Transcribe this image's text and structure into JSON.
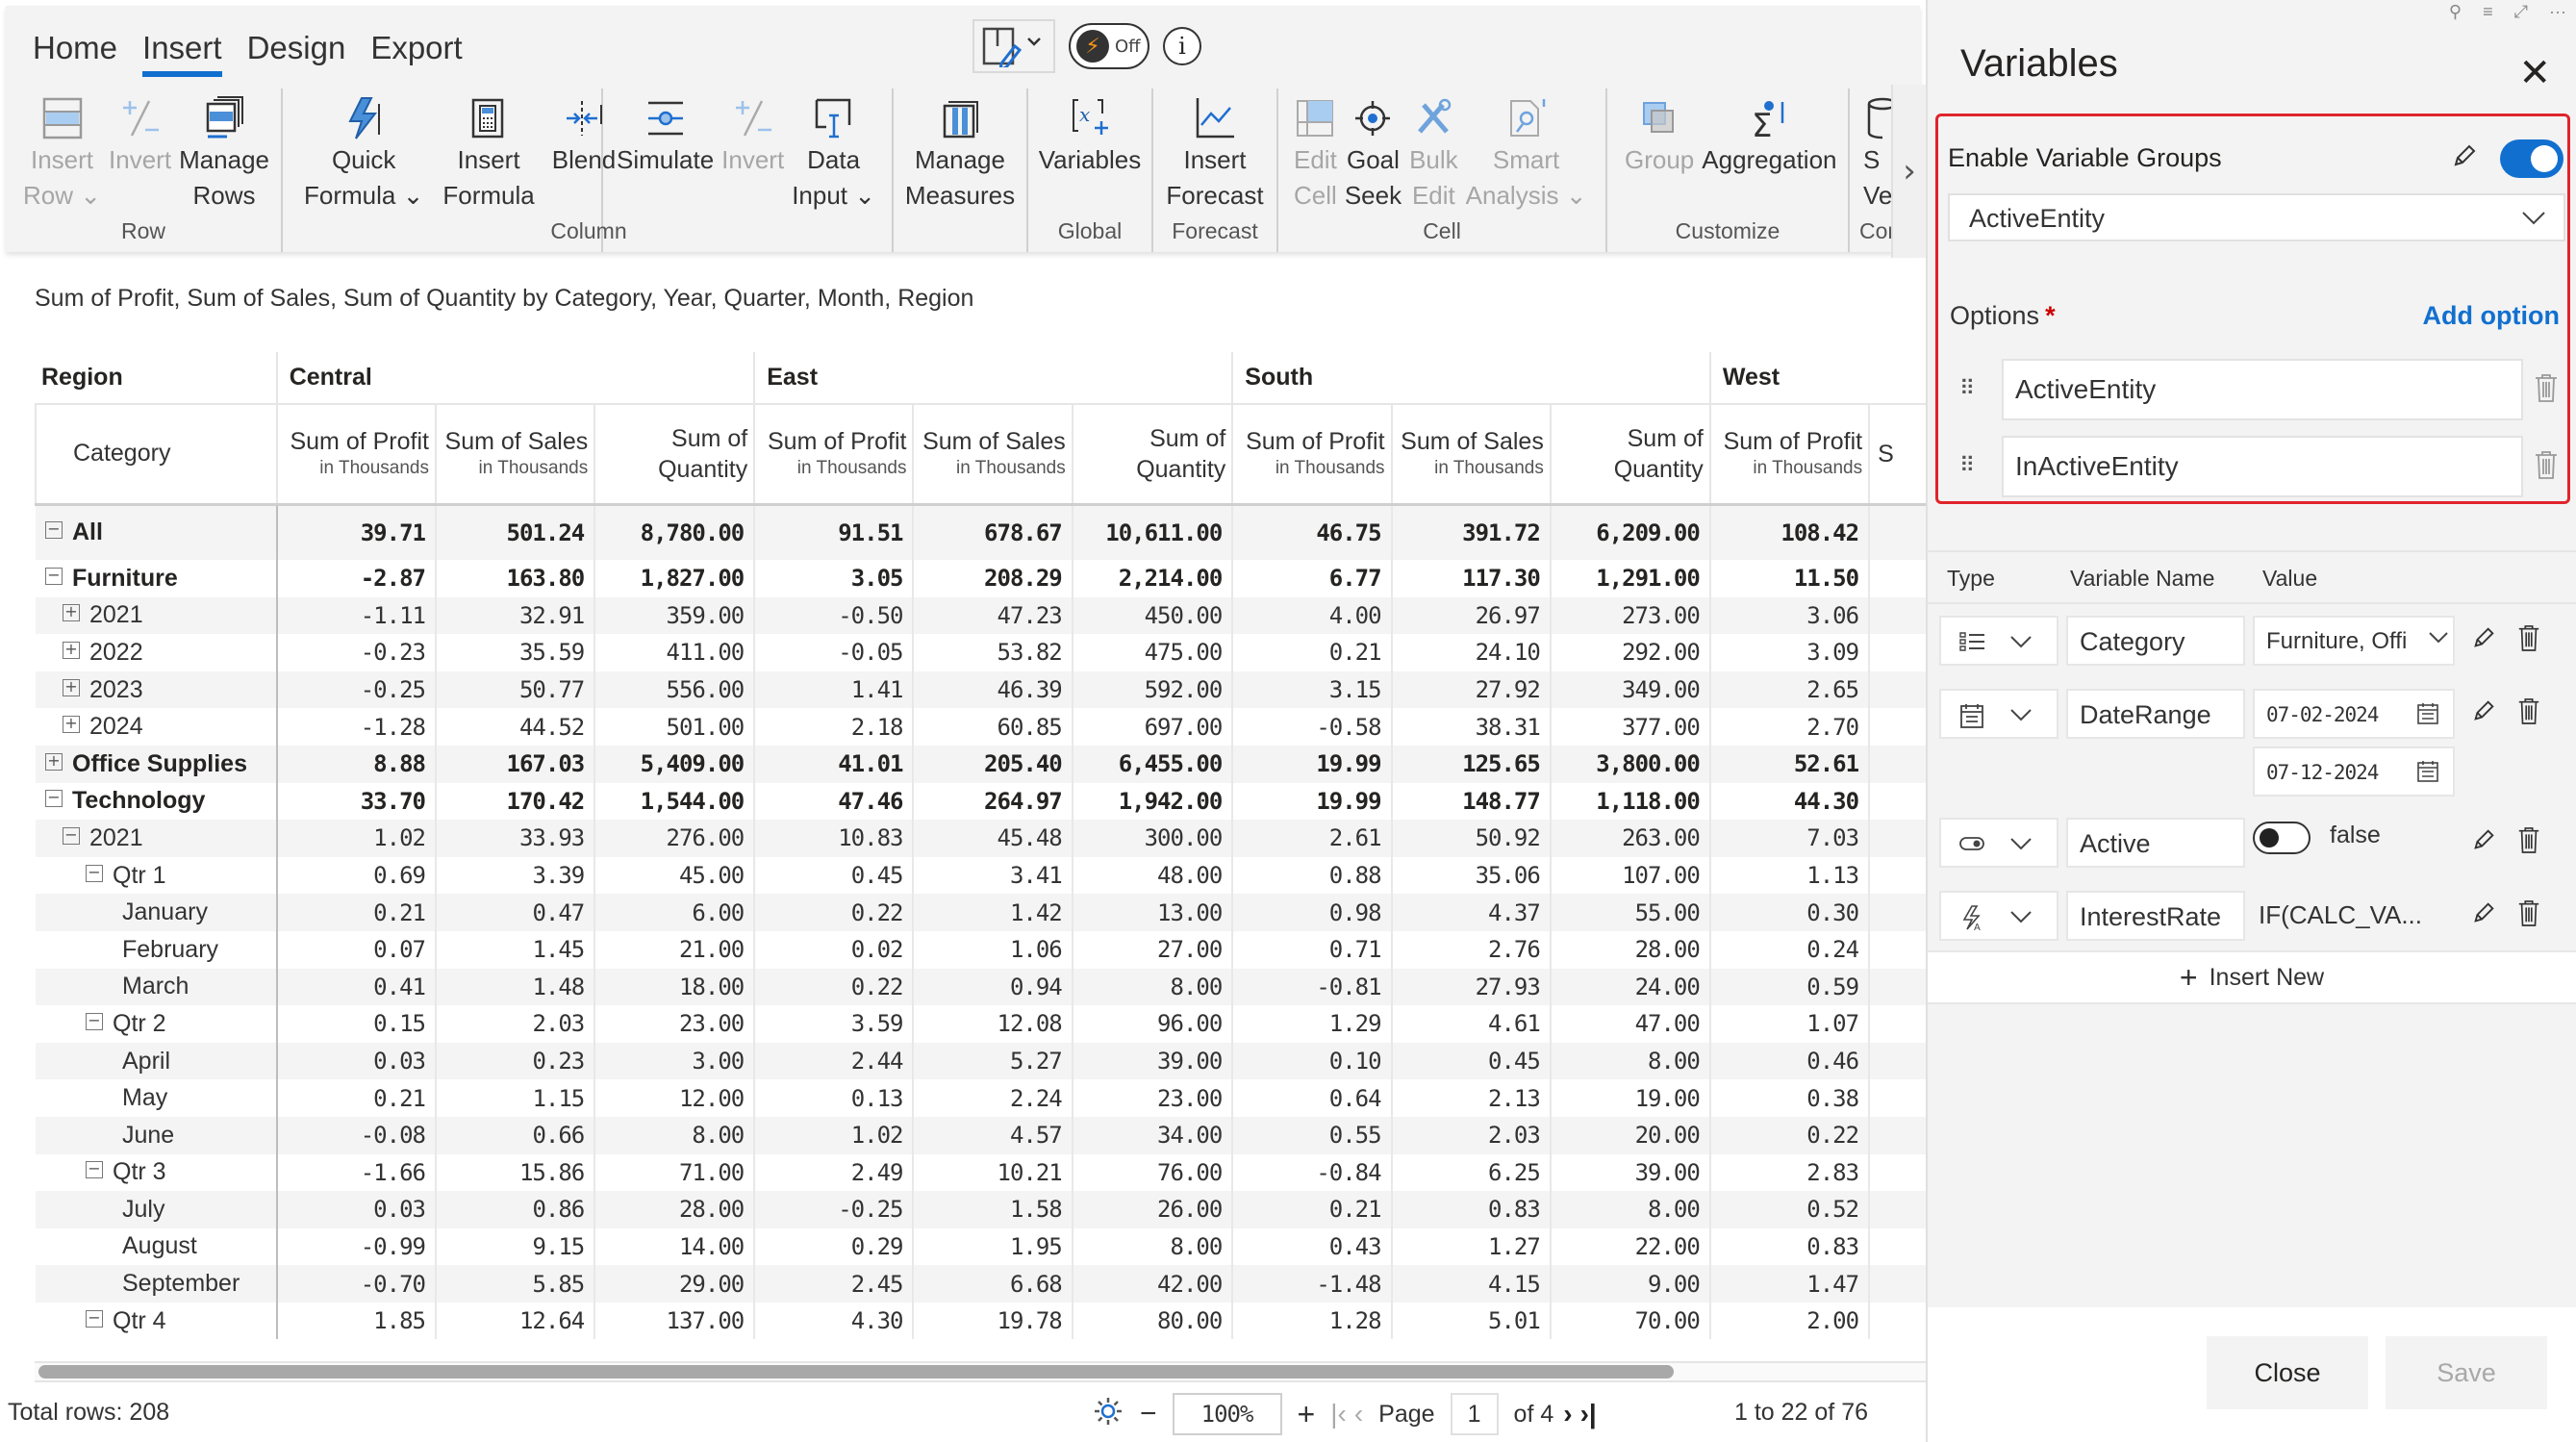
{
  "ribbon": {
    "tabs": [
      {
        "label": "Home",
        "active": false
      },
      {
        "label": "Insert",
        "active": true
      },
      {
        "label": "Design",
        "active": false
      },
      {
        "label": "Export",
        "active": false
      }
    ],
    "top_controls": {
      "layout_icon": "layout-edit-icon",
      "fast_mode_label": "Off",
      "info_icon": "info-icon"
    },
    "groups": [
      {
        "label": "Row",
        "buttons": [
          {
            "line1": "Insert",
            "line2": "Row ⌄",
            "icon": "insert-row-icon",
            "disabled": true
          },
          {
            "line1": "Invert",
            "line2": "",
            "icon": "invert-icon",
            "disabled": true
          },
          {
            "line1": "Manage",
            "line2": "Rows",
            "icon": "manage-rows-icon",
            "disabled": false
          }
        ]
      },
      {
        "label": "Column",
        "buttons": [
          {
            "line1": "Quick",
            "line2": "Formula ⌄",
            "icon": "quick-formula-icon",
            "disabled": false
          },
          {
            "line1": "Insert",
            "line2": "Formula",
            "icon": "insert-formula-icon",
            "disabled": false
          },
          {
            "line1": "Blend",
            "line2": "",
            "icon": "blend-icon",
            "disabled": false
          },
          {
            "line1": "Simulate",
            "line2": "",
            "icon": "simulate-icon",
            "disabled": false
          },
          {
            "line1": "Invert",
            "line2": "",
            "icon": "invert-icon",
            "disabled": true
          },
          {
            "line1": "Data",
            "line2": "Input ⌄",
            "icon": "data-input-icon",
            "disabled": false
          }
        ]
      },
      {
        "label": "",
        "buttons": [
          {
            "line1": "Manage",
            "line2": "Measures",
            "icon": "manage-measures-icon",
            "disabled": false
          }
        ]
      },
      {
        "label": "Global",
        "buttons": [
          {
            "line1": "Variables",
            "line2": "",
            "icon": "variables-icon",
            "disabled": false
          }
        ]
      },
      {
        "label": "Forecast",
        "buttons": [
          {
            "line1": "Insert",
            "line2": "Forecast",
            "icon": "forecast-icon",
            "disabled": false
          }
        ]
      },
      {
        "label": "Cell",
        "buttons": [
          {
            "line1": "Edit",
            "line2": "Cell",
            "icon": "edit-cell-icon",
            "disabled": true
          },
          {
            "line1": "Goal",
            "line2": "Seek",
            "icon": "goal-seek-icon",
            "disabled": false
          },
          {
            "line1": "Bulk",
            "line2": "Edit",
            "icon": "bulk-edit-icon",
            "disabled": true
          },
          {
            "line1": "Smart",
            "line2": "Analysis ⌄",
            "icon": "smart-analysis-icon",
            "disabled": true
          }
        ]
      },
      {
        "label": "Customize",
        "buttons": [
          {
            "line1": "Group",
            "line2": "",
            "icon": "group-icon",
            "disabled": true
          },
          {
            "line1": "Aggregation",
            "line2": "",
            "icon": "aggregation-icon",
            "disabled": false
          }
        ]
      },
      {
        "label": "Con",
        "buttons": [
          {
            "line1": "S",
            "line2": "Ver",
            "icon": "save-version-icon",
            "disabled": false
          }
        ]
      }
    ]
  },
  "report": {
    "subtitle": "Sum of Profit, Sum of Sales, Sum of Quantity by Category, Year, Quarter, Month, Region",
    "row_header_1": "Region",
    "row_header_2": "Category",
    "regions": [
      "Central",
      "East",
      "South",
      "West"
    ],
    "measures": [
      {
        "line1": "Sum of Profit",
        "line2": "in Thousands"
      },
      {
        "line1": "Sum of Sales",
        "line2": "in Thousands"
      },
      {
        "line1": "Sum of",
        "line2": "Quantity"
      }
    ],
    "truncated_next_measure": "S",
    "rows": [
      {
        "label": "All",
        "level": 0,
        "toggle": "−",
        "bold": true,
        "total": true,
        "values": [
          "39.71",
          "501.24",
          "8,780.00",
          "91.51",
          "678.67",
          "10,611.00",
          "46.75",
          "391.72",
          "6,209.00",
          "108.42"
        ]
      },
      {
        "label": "Furniture",
        "level": 0,
        "toggle": "−",
        "bold": true,
        "values": [
          "-2.87",
          "163.80",
          "1,827.00",
          "3.05",
          "208.29",
          "2,214.00",
          "6.77",
          "117.30",
          "1,291.00",
          "11.50"
        ]
      },
      {
        "label": "2021",
        "level": 1,
        "toggle": "+",
        "values": [
          "-1.11",
          "32.91",
          "359.00",
          "-0.50",
          "47.23",
          "450.00",
          "4.00",
          "26.97",
          "273.00",
          "3.06"
        ]
      },
      {
        "label": "2022",
        "level": 1,
        "toggle": "+",
        "values": [
          "-0.23",
          "35.59",
          "411.00",
          "-0.05",
          "53.82",
          "475.00",
          "0.21",
          "24.10",
          "292.00",
          "3.09"
        ]
      },
      {
        "label": "2023",
        "level": 1,
        "toggle": "+",
        "values": [
          "-0.25",
          "50.77",
          "556.00",
          "1.41",
          "46.39",
          "592.00",
          "3.15",
          "27.92",
          "349.00",
          "2.65"
        ]
      },
      {
        "label": "2024",
        "level": 1,
        "toggle": "+",
        "values": [
          "-1.28",
          "44.52",
          "501.00",
          "2.18",
          "60.85",
          "697.00",
          "-0.58",
          "38.31",
          "377.00",
          "2.70"
        ]
      },
      {
        "label": "Office Supplies",
        "level": 0,
        "toggle": "+",
        "bold": true,
        "values": [
          "8.88",
          "167.03",
          "5,409.00",
          "41.01",
          "205.40",
          "6,455.00",
          "19.99",
          "125.65",
          "3,800.00",
          "52.61"
        ]
      },
      {
        "label": "Technology",
        "level": 0,
        "toggle": "−",
        "bold": true,
        "values": [
          "33.70",
          "170.42",
          "1,544.00",
          "47.46",
          "264.97",
          "1,942.00",
          "19.99",
          "148.77",
          "1,118.00",
          "44.30"
        ]
      },
      {
        "label": "2021",
        "level": 1,
        "toggle": "−",
        "values": [
          "1.02",
          "33.93",
          "276.00",
          "10.83",
          "45.48",
          "300.00",
          "2.61",
          "50.92",
          "263.00",
          "7.03"
        ]
      },
      {
        "label": "Qtr 1",
        "level": 2,
        "toggle": "−",
        "values": [
          "0.69",
          "3.39",
          "45.00",
          "0.45",
          "3.41",
          "48.00",
          "0.88",
          "35.06",
          "107.00",
          "1.13"
        ]
      },
      {
        "label": "January",
        "level": 3,
        "toggle": "",
        "values": [
          "0.21",
          "0.47",
          "6.00",
          "0.22",
          "1.42",
          "13.00",
          "0.98",
          "4.37",
          "55.00",
          "0.30"
        ]
      },
      {
        "label": "February",
        "level": 3,
        "toggle": "",
        "values": [
          "0.07",
          "1.45",
          "21.00",
          "0.02",
          "1.06",
          "27.00",
          "0.71",
          "2.76",
          "28.00",
          "0.24"
        ]
      },
      {
        "label": "March",
        "level": 3,
        "toggle": "",
        "values": [
          "0.41",
          "1.48",
          "18.00",
          "0.22",
          "0.94",
          "8.00",
          "-0.81",
          "27.93",
          "24.00",
          "0.59"
        ]
      },
      {
        "label": "Qtr 2",
        "level": 2,
        "toggle": "−",
        "values": [
          "0.15",
          "2.03",
          "23.00",
          "3.59",
          "12.08",
          "96.00",
          "1.29",
          "4.61",
          "47.00",
          "1.07"
        ]
      },
      {
        "label": "April",
        "level": 3,
        "toggle": "",
        "values": [
          "0.03",
          "0.23",
          "3.00",
          "2.44",
          "5.27",
          "39.00",
          "0.10",
          "0.45",
          "8.00",
          "0.46"
        ]
      },
      {
        "label": "May",
        "level": 3,
        "toggle": "",
        "values": [
          "0.21",
          "1.15",
          "12.00",
          "0.13",
          "2.24",
          "23.00",
          "0.64",
          "2.13",
          "19.00",
          "0.38"
        ]
      },
      {
        "label": "June",
        "level": 3,
        "toggle": "",
        "values": [
          "-0.08",
          "0.66",
          "8.00",
          "1.02",
          "4.57",
          "34.00",
          "0.55",
          "2.03",
          "20.00",
          "0.22"
        ]
      },
      {
        "label": "Qtr 3",
        "level": 2,
        "toggle": "−",
        "values": [
          "-1.66",
          "15.86",
          "71.00",
          "2.49",
          "10.21",
          "76.00",
          "-0.84",
          "6.25",
          "39.00",
          "2.83"
        ]
      },
      {
        "label": "July",
        "level": 3,
        "toggle": "",
        "values": [
          "0.03",
          "0.86",
          "28.00",
          "-0.25",
          "1.58",
          "26.00",
          "0.21",
          "0.83",
          "8.00",
          "0.52"
        ]
      },
      {
        "label": "August",
        "level": 3,
        "toggle": "",
        "values": [
          "-0.99",
          "9.15",
          "14.00",
          "0.29",
          "1.95",
          "8.00",
          "0.43",
          "1.27",
          "22.00",
          "0.83"
        ]
      },
      {
        "label": "September",
        "level": 3,
        "toggle": "",
        "values": [
          "-0.70",
          "5.85",
          "29.00",
          "2.45",
          "6.68",
          "42.00",
          "-1.48",
          "4.15",
          "9.00",
          "1.47"
        ]
      },
      {
        "label": "Qtr 4",
        "level": 2,
        "toggle": "−",
        "values": [
          "1.85",
          "12.64",
          "137.00",
          "4.30",
          "19.78",
          "80.00",
          "1.28",
          "5.01",
          "70.00",
          "2.00"
        ]
      }
    ]
  },
  "footer": {
    "total_rows": "Total rows: 208",
    "zoom_minus": "−",
    "zoom_value": "100%",
    "zoom_plus": "+",
    "page_label": "Page",
    "page_value": "1",
    "page_of": "of 4",
    "range": "1 to 22 of 76",
    "scroll_position_percent": 0
  },
  "panel": {
    "title": "Variables",
    "enable_groups_label": "Enable Variable Groups",
    "enable_groups_on": true,
    "group_selected": "ActiveEntity",
    "options_label": "Options",
    "required_mark": "*",
    "add_option": "Add option",
    "options": [
      "ActiveEntity",
      "InActiveEntity"
    ],
    "table_headers": {
      "type": "Type",
      "name": "Variable Name",
      "value": "Value"
    },
    "variables": [
      {
        "type_icon": "list-icon",
        "name": "Category",
        "value": "Furniture, Offi",
        "kind": "select"
      },
      {
        "type_icon": "calendar-icon",
        "name": "DateRange",
        "value_from": "07-02-2024",
        "value_to": "07-12-2024",
        "kind": "daterange"
      },
      {
        "type_icon": "toggle-icon",
        "name": "Active",
        "value": "false",
        "kind": "boolean"
      },
      {
        "type_icon": "formula-icon",
        "name": "InterestRate",
        "value": "IF(CALC_VA...",
        "kind": "formula"
      }
    ],
    "insert_new": "Insert New",
    "close_button": "Close",
    "save_button": "Save"
  },
  "colors": {
    "accent": "#1170cf",
    "highlight_border": "#e0242b",
    "required": "#cc0000"
  }
}
